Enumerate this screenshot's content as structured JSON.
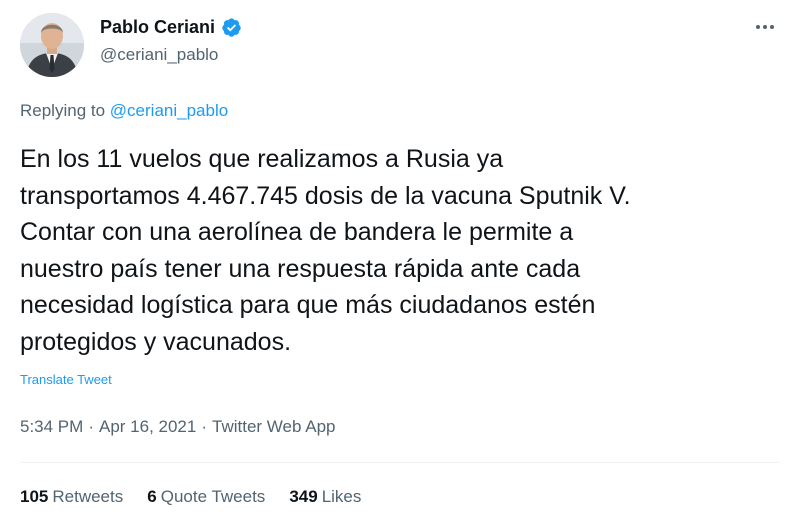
{
  "author": {
    "name": "Pablo Ceriani",
    "handle": "@ceriani_pablo",
    "verified": true
  },
  "reply": {
    "prefix": "Replying to",
    "handle": "@ceriani_pablo"
  },
  "tweet": {
    "lines": [
      "En los 11 vuelos que realizamos a Rusia ya",
      "transportamos 4.467.745 dosis de la vacuna Sputnik V.",
      "Contar con una aerolínea de bandera le permite a",
      "nuestro país tener una respuesta rápida ante cada",
      "necesidad logística para que más ciudadanos estén",
      "protegidos y vacunados."
    ],
    "translate_label": "Translate Tweet"
  },
  "meta": {
    "time": "5:34 PM",
    "separator": "·",
    "date": "Apr 16, 2021",
    "app": "Twitter Web App"
  },
  "stats": {
    "retweets_count": "105",
    "retweets_label": "Retweets",
    "quote_count": "6",
    "quote_label": "Quote Tweets",
    "likes_count": "349",
    "likes_label": "Likes"
  },
  "icons": {
    "verified": "verified-badge-icon",
    "more": "more-options-icon"
  },
  "colors": {
    "accent": "#1d9bf0",
    "secondary_text": "#536471",
    "primary_text": "#0f1419"
  }
}
